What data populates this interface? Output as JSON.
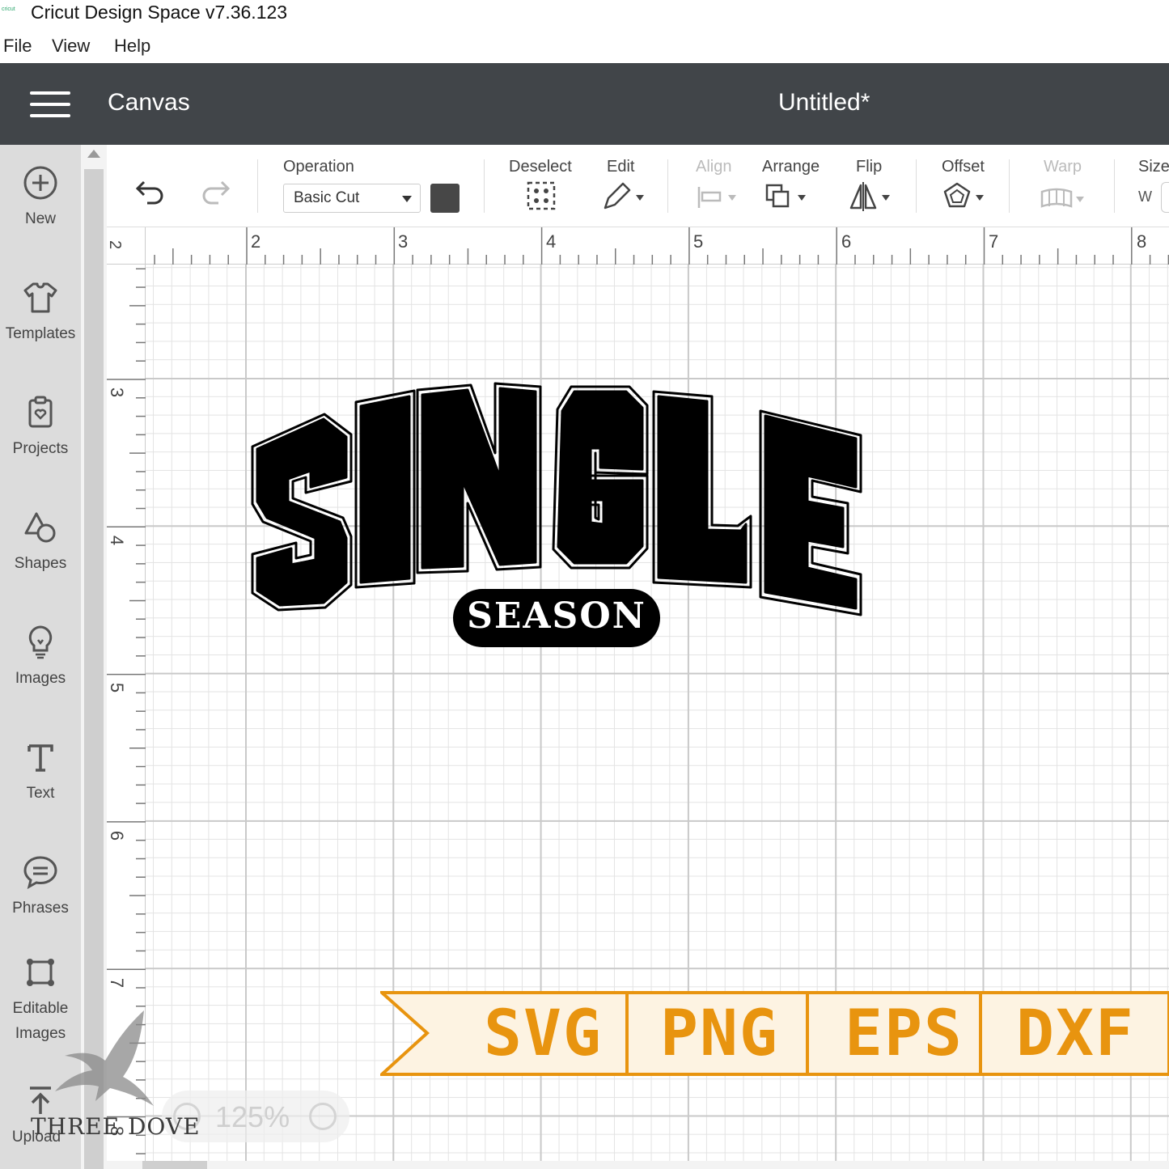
{
  "window": {
    "title": "Cricut Design Space  v7.36.123",
    "icon_text": "cricut"
  },
  "menu": [
    "File",
    "View",
    "Help"
  ],
  "header": {
    "section": "Canvas",
    "document": "Untitled*"
  },
  "sidebar": [
    {
      "label": "New",
      "icon": "plus-circle-icon"
    },
    {
      "label": "Templates",
      "icon": "tshirt-icon"
    },
    {
      "label": "Projects",
      "icon": "project-icon"
    },
    {
      "label": "Shapes",
      "icon": "shapes-icon"
    },
    {
      "label": "Images",
      "icon": "lightbulb-icon"
    },
    {
      "label": "Text",
      "icon": "text-icon"
    },
    {
      "label": "Phrases",
      "icon": "speech-bubble-icon"
    },
    {
      "label": "Editable",
      "label2": "Images",
      "icon": "editable-images-icon"
    },
    {
      "label": "Upload",
      "icon": "upload-icon"
    }
  ],
  "toolbar": {
    "operation_label": "Operation",
    "operation_value": "Basic Cut",
    "operation_color": "#474747",
    "deselect": "Deselect",
    "edit": "Edit",
    "align": "Align",
    "arrange": "Arrange",
    "flip": "Flip",
    "offset": "Offset",
    "warp": "Warp",
    "size": "Size",
    "size_w": "W"
  },
  "ruler": {
    "top": [
      "2",
      "2",
      "3",
      "4",
      "5",
      "6",
      "7",
      "8"
    ],
    "left": [
      "3",
      "4",
      "5",
      "6",
      "7",
      "8"
    ]
  },
  "design": {
    "main_text": "SINGLE",
    "sub_text": "SEASON"
  },
  "formats": {
    "items": [
      "SVG",
      "PNG",
      "EPS",
      "DXF"
    ],
    "color": "#E8940F",
    "bg": "#FDF3E2"
  },
  "zoom": {
    "value": "125%"
  },
  "watermark": {
    "text": "THREE DOVE"
  }
}
